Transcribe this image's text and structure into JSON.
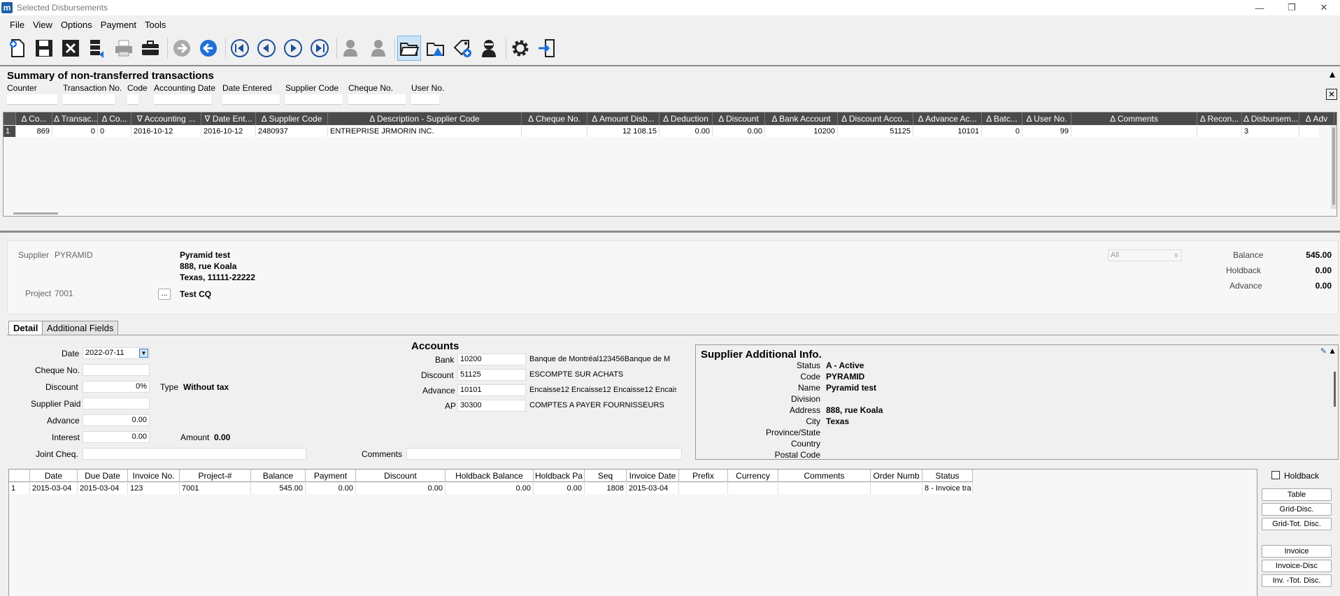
{
  "window": {
    "title": "Selected Disbursements",
    "app_icon": "m"
  },
  "menu": [
    "File",
    "View",
    "Options",
    "Payment",
    "Tools"
  ],
  "toolbar": [
    "new-icon",
    "save-icon",
    "delete-icon",
    "transfer-icon",
    "print-icon",
    "briefcase-icon",
    "forward-arrow-icon",
    "back-arrow-icon",
    "first-record-icon",
    "previous-record-icon",
    "next-record-icon",
    "last-record-icon",
    "user-settings-icon",
    "user-config-icon",
    "open-folder-icon",
    "folder-warning-icon",
    "tag-add-icon",
    "agent-icon",
    "gear-icon",
    "exit-icon"
  ],
  "summary": {
    "title": "Summary of non-transferred transactions",
    "filters": [
      "Counter",
      "Transaction No.",
      "Code",
      "Accounting Date",
      "Date Entered",
      "Supplier Code",
      "Cheque No.",
      "User No."
    ],
    "columns": [
      "Δ",
      "Co...",
      "Δ",
      "Transac...",
      "Δ",
      "Co...",
      "∇",
      "Accounting ...",
      "∇",
      "Date Ent...",
      "Δ",
      "Supplier Code",
      "Δ",
      "Description - Supplier Code",
      "Δ",
      "Cheque No.",
      "Δ",
      "Amount Disb...",
      "Δ",
      "Deduction",
      "Δ",
      "Discount",
      "Δ",
      "Bank Account",
      "Δ",
      "Discount Acco...",
      "Δ",
      "Advance Ac...",
      "Δ",
      "Batc...",
      "Δ",
      "User No.",
      "Δ",
      "Comments",
      "Δ",
      "Recon...",
      "Δ",
      "Disbursem...",
      "Δ",
      "Adv"
    ],
    "row": {
      "num": "1",
      "counter": "869",
      "trans": "0",
      "code": "0",
      "acc_date": "2016-10-12",
      "date_entered": "2016-10-12",
      "supplier_code": "2480937",
      "description": "ENTREPRISE JRMORIN INC.",
      "cheque": "",
      "amount": "12 108.15",
      "deduction": "0.00",
      "discount": "0.00",
      "bank": "10200",
      "disc_acc": "51125",
      "adv_acc": "10101",
      "batch": "0",
      "user": "99",
      "comments": "",
      "recon": "",
      "disb": "3"
    }
  },
  "supplier": {
    "label": "Supplier",
    "code": "PYRAMID",
    "name": "Pyramid test",
    "addr1": "888, rue Koala",
    "addr2": "Texas, 11111-22222",
    "project_label": "Project",
    "project_code": "7001",
    "project_btn": "...",
    "project_name": "Test CQ",
    "filter": "All",
    "balance_label": "Balance",
    "balance": "545.00",
    "holdback_label": "Holdback",
    "holdback": "0.00",
    "advance_label": "Advance",
    "advance": "0.00"
  },
  "tabs": [
    "Detail",
    "Additional Fields"
  ],
  "detail": {
    "date_label": "Date",
    "date": "2022-07-11",
    "cheque_label": "Cheque No.",
    "cheque": "",
    "discount_label": "Discount",
    "discount": "0%",
    "type_label": "Type",
    "type": "Without tax",
    "supplier_paid_label": "Supplier Paid",
    "supplier_paid": "",
    "advance_label": "Advance",
    "advance": "0.00",
    "interest_label": "Interest",
    "interest": "0.00",
    "amount_label": "Amount",
    "amount": "0.00",
    "joint_label": "Joint Cheq.",
    "joint": "",
    "comments_label": "Comments",
    "comments": ""
  },
  "accounts": {
    "title": "Accounts",
    "rows": [
      {
        "label": "Bank",
        "code": "10200",
        "desc": "Banque de Montréal123456Banque de M"
      },
      {
        "label": "Discount",
        "code": "51125",
        "desc": "ESCOMPTE SUR ACHATS"
      },
      {
        "label": "Advance",
        "code": "10101",
        "desc": "Encaisse12 Encaisse12 Encaisse12 Encais"
      },
      {
        "label": "AP",
        "code": "30300",
        "desc": "COMPTES A PAYER FOURNISSEURS"
      }
    ]
  },
  "supinfo": {
    "title": "Supplier Additional Info.",
    "rows": [
      {
        "label": "Status",
        "value": "A - Active"
      },
      {
        "label": "Code",
        "value": "PYRAMID"
      },
      {
        "label": "Name",
        "value": "Pyramid test"
      },
      {
        "label": "Division",
        "value": ""
      },
      {
        "label": "Address",
        "value": "888, rue Koala"
      },
      {
        "label": "City",
        "value": "Texas"
      },
      {
        "label": "Province/State",
        "value": ""
      },
      {
        "label": "Country",
        "value": ""
      },
      {
        "label": "Postal Code",
        "value": ""
      }
    ]
  },
  "invoices": {
    "columns": [
      "",
      "Date",
      "Due Date",
      "Invoice No.",
      "Project-#",
      "Balance",
      "Payment",
      "Discount",
      "Holdback Balance",
      "Holdback Pa",
      "Seq",
      "Invoice Date",
      "Prefix",
      "Currency",
      "Comments",
      "Order Numb",
      "Status"
    ],
    "row": [
      "1",
      "2015-03-04",
      "2015-03-04",
      "123",
      "7001",
      "545.00",
      "0.00",
      "0.00",
      "0.00",
      "0.00",
      "1808",
      "2015-03-04",
      "",
      "",
      "",
      "",
      "8 - Invoice tra"
    ]
  },
  "side": {
    "holdback": "Holdback",
    "buttons": [
      "Table",
      "Grid-Disc.",
      "Grid-Tot. Disc.",
      "Invoice",
      "Invoice-Disc",
      "Inv. -Tot. Disc."
    ]
  }
}
